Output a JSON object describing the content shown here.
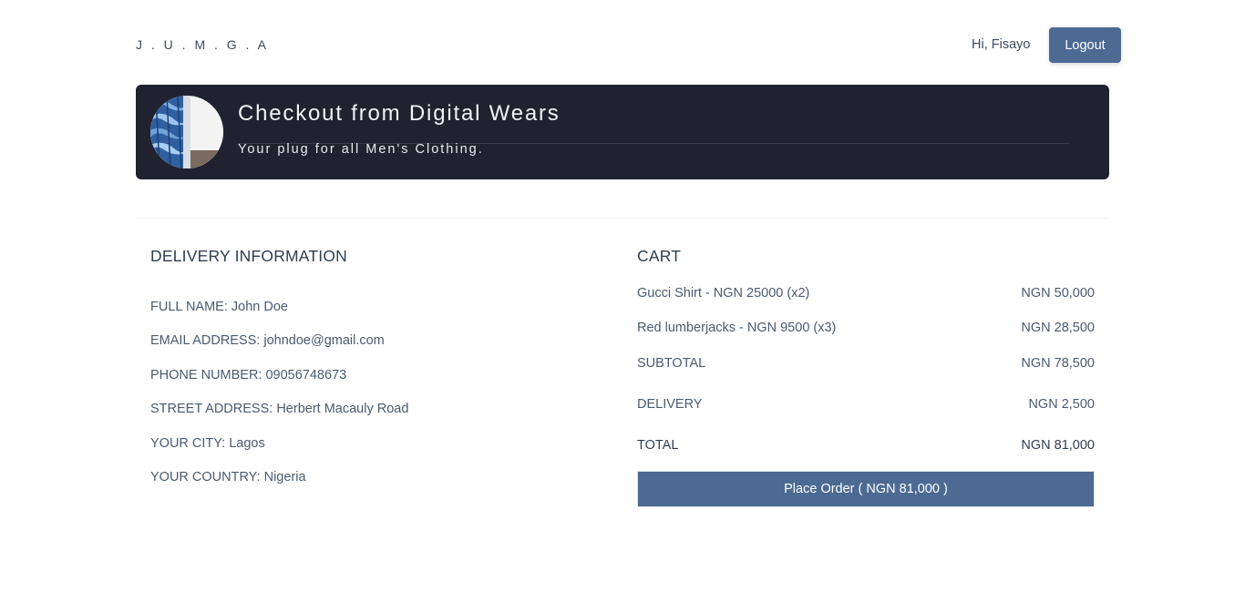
{
  "header": {
    "brand": "J . U . M . G . A",
    "greeting": "Hi, Fisayo",
    "logout_label": "Logout"
  },
  "banner": {
    "title": "Checkout from Digital Wears",
    "subtitle": "Your plug for all Men's Clothing."
  },
  "delivery": {
    "heading": "DELIVERY INFORMATION",
    "lines": [
      "FULL NAME: John Doe",
      "EMAIL ADDRESS: johndoe@gmail.com",
      "PHONE NUMBER: 09056748673",
      "STREET ADDRESS: Herbert Macauly Road",
      "YOUR CITY: Lagos",
      "YOUR COUNTRY: Nigeria"
    ]
  },
  "cart": {
    "heading": "CART",
    "items": [
      {
        "label": "Gucci Shirt - NGN 25000 (x2)",
        "amount": "NGN 50,000"
      },
      {
        "label": "Red lumberjacks - NGN 9500 (x3)",
        "amount": "NGN 28,500"
      }
    ],
    "subtotal": {
      "label": "SUBTOTAL",
      "amount": "NGN 78,500"
    },
    "delivery": {
      "label": "DELIVERY",
      "amount": "NGN 2,500"
    },
    "total": {
      "label": "TOTAL",
      "amount": "NGN 81,000"
    },
    "place_order_label": "Place Order ( NGN 81,000 )"
  },
  "colors": {
    "accent": "#4c6a92",
    "banner_bg": "#20222f",
    "text": "#4a5a70"
  }
}
